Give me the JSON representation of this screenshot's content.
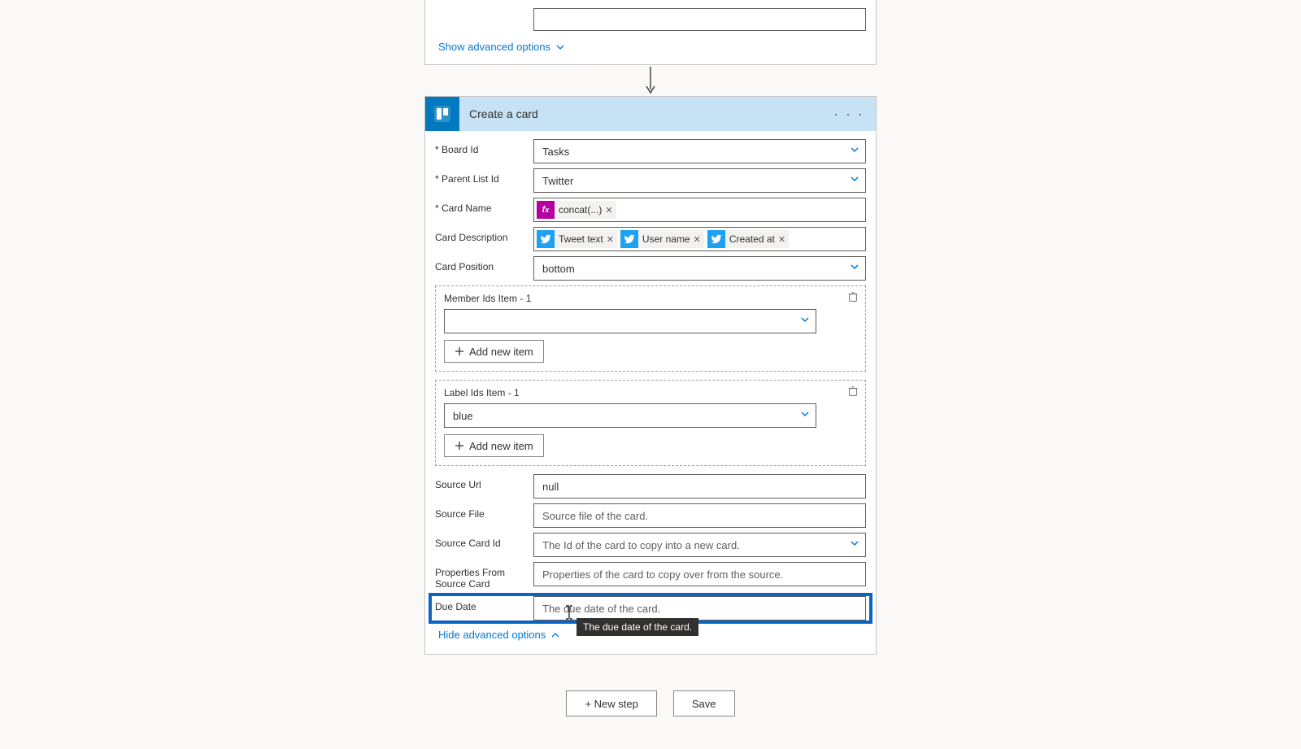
{
  "partial": {
    "show_advanced": "Show advanced options"
  },
  "step": {
    "title": "Create a card"
  },
  "labels": {
    "board": "Board Id",
    "parent": "Parent List Id",
    "cardname": "Card Name",
    "desc": "Card Description",
    "pos": "Card Position",
    "member": "Member Ids Item - 1",
    "labelids": "Label Ids Item - 1",
    "sourceurl": "Source Url",
    "sourcefile": "Source File",
    "sourcecard": "Source Card Id",
    "props": "Properties From Source Card",
    "due": "Due Date"
  },
  "values": {
    "board": "Tasks",
    "parent": "Twitter",
    "pos": "bottom",
    "labelcolor": "blue",
    "sourceurl": "null"
  },
  "tokens": {
    "concat": "concat(...)",
    "tweettext": "Tweet text",
    "username": "User name",
    "createdat": "Created at"
  },
  "placeholders": {
    "sourcefile": "Source file of the card.",
    "sourcecard": "The Id of the card to copy into a new card.",
    "props": "Properties of the card to copy over from the source.",
    "due": "The due date of the card."
  },
  "buttons": {
    "addnew": "Add new item",
    "hideadv": "Hide advanced options",
    "newstep": "+ New step",
    "save": "Save"
  },
  "tooltip": "The due date of the card."
}
